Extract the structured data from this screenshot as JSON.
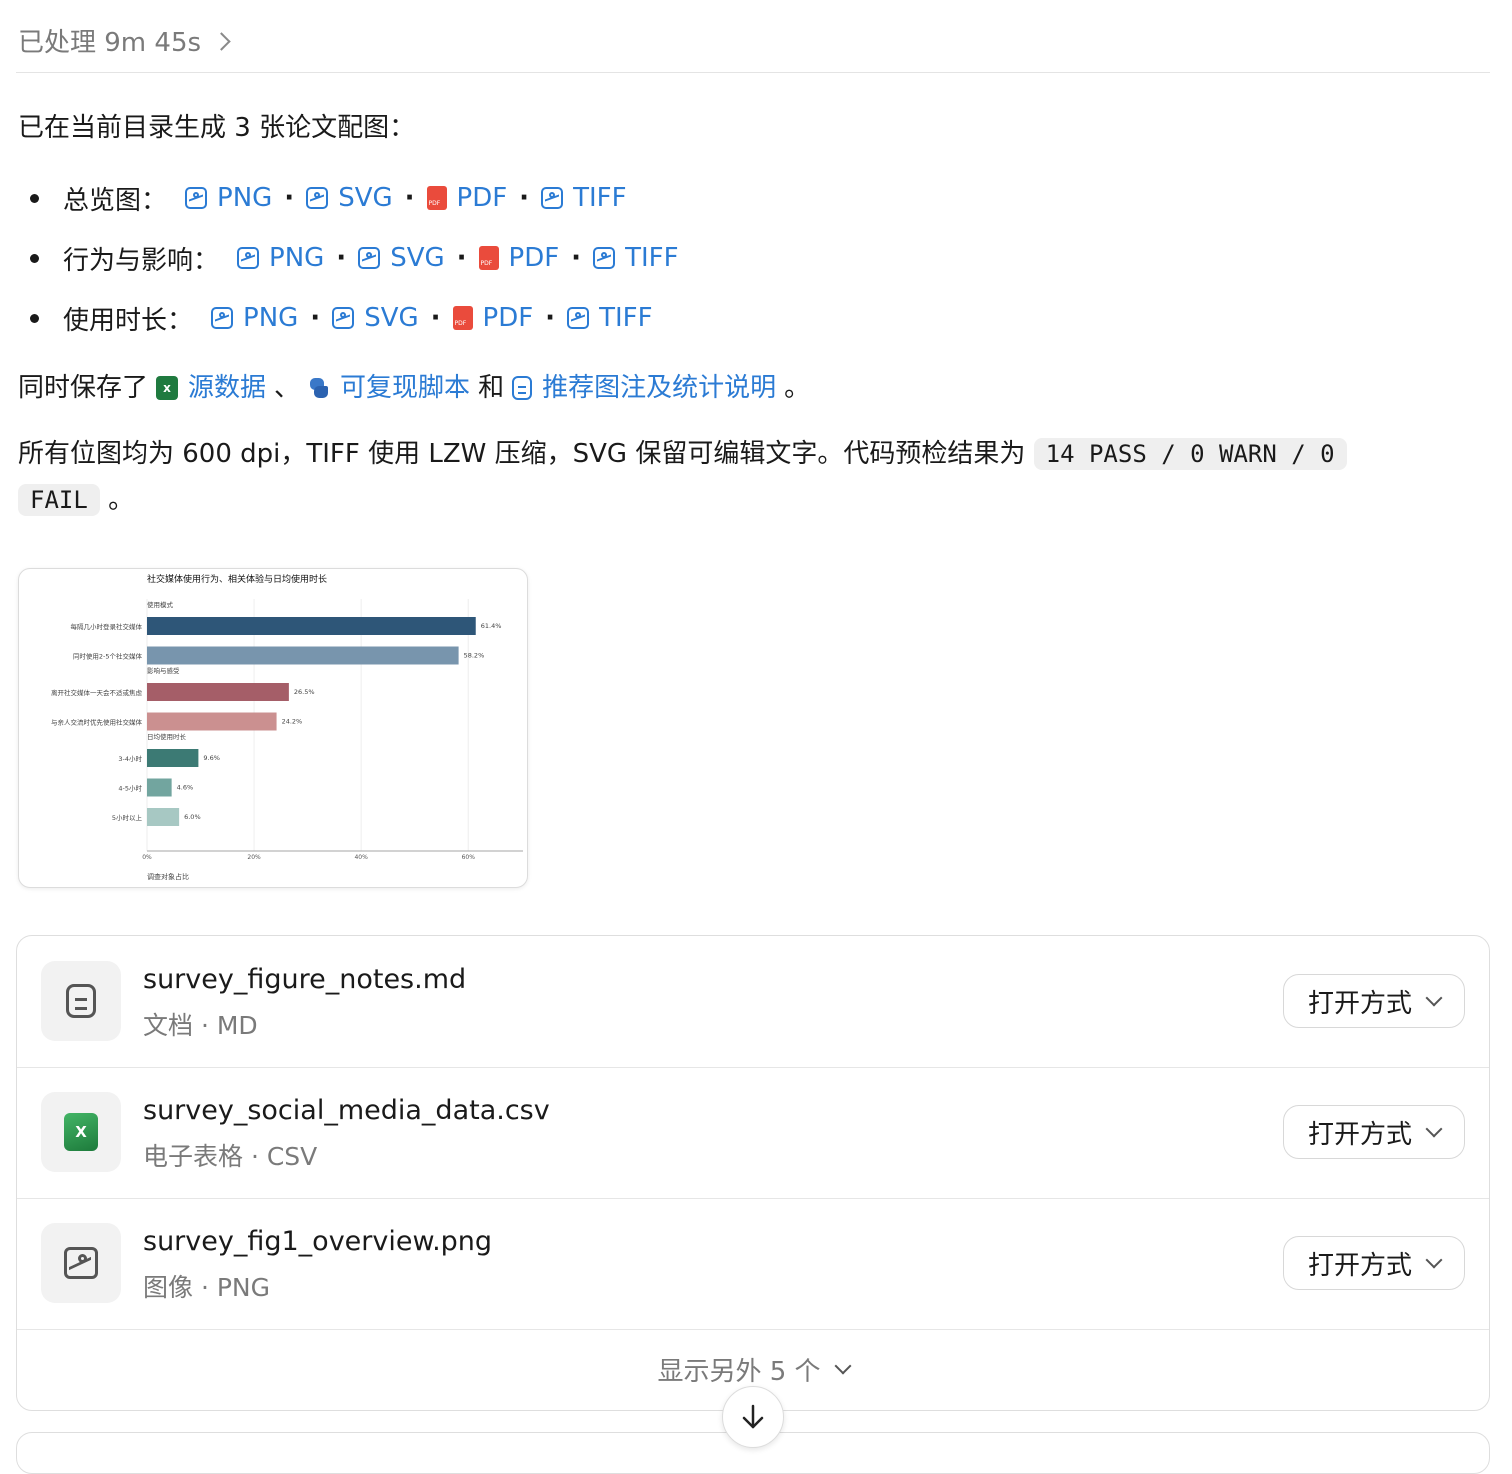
{
  "header": {
    "status": "已处理 9m 45s"
  },
  "intro": "已在当前目录生成 3 张论文配图：",
  "figures": [
    {
      "label": "总览图：",
      "formats": [
        "PNG",
        "SVG",
        "PDF",
        "TIFF"
      ]
    },
    {
      "label": "行为与影响：",
      "formats": [
        "PNG",
        "SVG",
        "PDF",
        "TIFF"
      ]
    },
    {
      "label": "使用时长：",
      "formats": [
        "PNG",
        "SVG",
        "PDF",
        "TIFF"
      ]
    }
  ],
  "separator": "·",
  "saved": {
    "prefix": "同时保存了",
    "source_data": "源数据",
    "comma": "、",
    "script": "可复现脚本",
    "and": "和",
    "notes": "推荐图注及统计说明",
    "end": "。"
  },
  "summary": {
    "line1": "所有位图均为 600 dpi，TIFF 使用 LZW 压缩，SVG 保留可编辑文字。代码预检结果为",
    "code1": "14 PASS / 0 WARN / 0",
    "code2": "FAIL",
    "end": "。"
  },
  "chart_data": {
    "type": "bar",
    "orientation": "horizontal",
    "title": "社交媒体使用行为、相关体验与日均使用时长",
    "xlabel": "调查对象占比",
    "xlim": [
      0,
      70
    ],
    "xticks": [
      "0%",
      "20%",
      "40%",
      "60%"
    ],
    "groups": [
      {
        "name": "使用模式",
        "bars": [
          {
            "label": "每隔几小时登录社交媒体",
            "value": 61.4,
            "text": "61.4%",
            "color": "#2e5678"
          },
          {
            "label": "同时使用2-5个社交媒体",
            "value": 58.2,
            "text": "58.2%",
            "color": "#7895ad"
          }
        ]
      },
      {
        "name": "影响与感受",
        "bars": [
          {
            "label": "离开社交媒体一天会不适或焦虑",
            "value": 26.5,
            "text": "26.5%",
            "color": "#a55e68"
          },
          {
            "label": "与亲人交流时优先使用社交媒体",
            "value": 24.2,
            "text": "24.2%",
            "color": "#cb9090"
          }
        ]
      },
      {
        "name": "日均使用时长",
        "bars": [
          {
            "label": "3-4小时",
            "value": 9.6,
            "text": "9.6%",
            "color": "#3c7a74"
          },
          {
            "label": "4-5小时",
            "value": 4.6,
            "text": "4.6%",
            "color": "#72a59f"
          },
          {
            "label": "5小时以上",
            "value": 6.0,
            "text": "6.0%",
            "color": "#a7c8c3"
          }
        ]
      }
    ]
  },
  "files": [
    {
      "name": "survey_figure_notes.md",
      "meta": "文档 · MD",
      "icon": "document-icon",
      "action": "打开方式"
    },
    {
      "name": "survey_social_media_data.csv",
      "meta": "电子表格 · CSV",
      "icon": "spreadsheet-icon",
      "action": "打开方式"
    },
    {
      "name": "survey_fig1_overview.png",
      "meta": "图像 · PNG",
      "icon": "image-icon",
      "action": "打开方式"
    }
  ],
  "more": "显示另外 5 个",
  "colors": {
    "link": "#2b7bd4",
    "muted": "#7a7a7a"
  }
}
